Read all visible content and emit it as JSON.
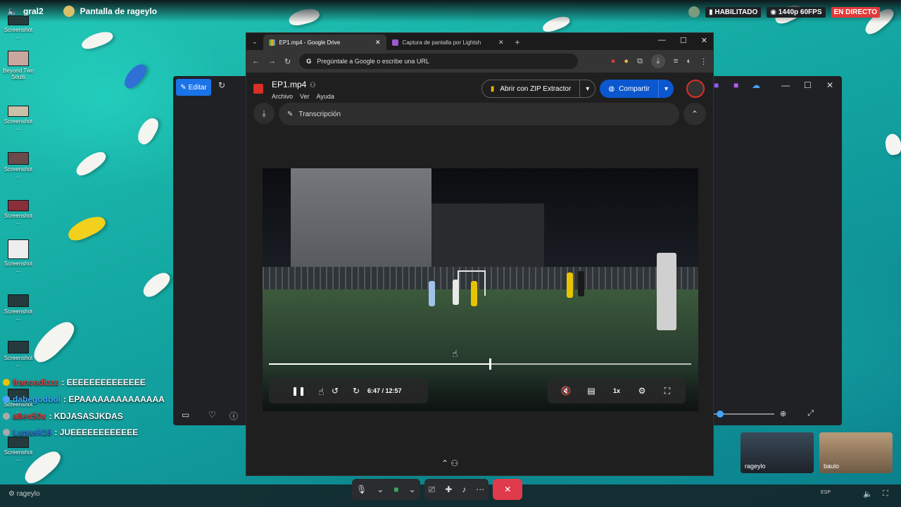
{
  "overlay": {
    "channel": "gral2",
    "screen_title": "Pantalla de rageylo",
    "status_enabled": "HABILITADO",
    "quality": "1440p 60FPS",
    "live": "EN DIRECTO"
  },
  "desktop_icons": [
    {
      "label": "Screenshot ..."
    },
    {
      "label": "Beyond Two Souls"
    },
    {
      "label": "Screenshot ..."
    },
    {
      "label": "Screenshot ..."
    },
    {
      "label": "Screenshot ..."
    },
    {
      "label": "Screenshot ..."
    },
    {
      "label": "Screenshot ..."
    },
    {
      "label": "Screenshot ..."
    },
    {
      "label": "Screenshot ..."
    },
    {
      "label": "Screenshot ..."
    }
  ],
  "bg_window": {
    "edit_label": "Editar"
  },
  "browser": {
    "tabs": [
      {
        "title": "EP1.mp4 - Google Drive"
      },
      {
        "title": "Captura de pantalla por Lightsh"
      }
    ],
    "omnibox_placeholder": "Pregúntale a Google o escribe una URL"
  },
  "drive": {
    "file_name": "EP1.mp4",
    "menus": [
      "Archivo",
      "Ver",
      "Ayuda"
    ],
    "zip_button": "Abrir con ZIP Extractor",
    "share_button": "Compartir",
    "transcript_label": "Transcripción"
  },
  "player": {
    "current_time": "6:47",
    "duration": "12:57",
    "speed": "1x",
    "progress_fraction": 0.524
  },
  "chat": [
    {
      "user": "francodizzz",
      "message": ": EEEEEEEEEEEEEE"
    },
    {
      "user": "dabegodboi",
      "message": ": EPAAAAAAAAAAAAAA"
    },
    {
      "user": "a8en50x",
      "message": ": KDJASASJKDAS"
    },
    {
      "user": "Lupask16",
      "message": ": JUEEEEEEEEEEEE"
    }
  ],
  "cams": [
    {
      "name": "rageylo"
    },
    {
      "name": "baulo"
    }
  ],
  "taskbar": {
    "user": "rageylo",
    "lang": "ESP"
  },
  "colors": {
    "accent": "#1a73e8",
    "share": "#0b57d0",
    "live": "#e03a3a",
    "hangup": "#e03a4d"
  }
}
